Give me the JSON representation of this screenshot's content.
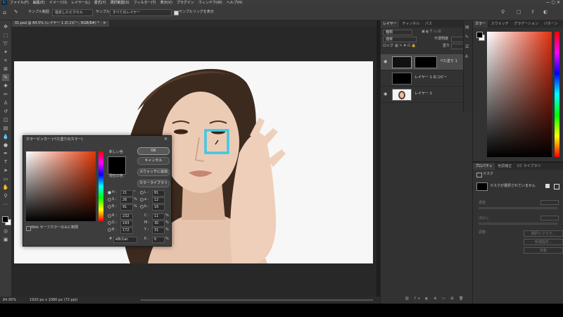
{
  "menu": {
    "logo": "Ps",
    "items": [
      "ファイル(F)",
      "編集(E)",
      "イメージ(I)",
      "レイヤー(L)",
      "書式(Y)",
      "選択範囲(S)",
      "フィルター(T)",
      "表示(V)",
      "プラグイン",
      "ウィンドウ(W)",
      "ヘルプ(H)"
    ]
  },
  "options": {
    "sample_size_label": "サンプル範囲",
    "sample_size_value": "指定したピクセル",
    "sample_label": "サンプル",
    "sample_value": "すべてのレイヤー",
    "show_ring_label": "サンプルリングを表示"
  },
  "document": {
    "tab_title": "01.psd @ 84.5% (レイヤー 1 のコピー, RGB/8#) *",
    "zoom": "84.95%",
    "size_info": "1920 px x 1080 px (72 ppi)"
  },
  "layers_panel": {
    "tabs": [
      "レイヤー",
      "チャンネル",
      "パス"
    ],
    "search_placeholder": "種類",
    "blend_mode": "通常",
    "opacity_label": "不透明度",
    "lock_label": "ロック",
    "fill_label": "塗り",
    "layers": [
      {
        "name": "べた塗り 1",
        "visible": true
      },
      {
        "name": "レイヤー 1 のコピー",
        "visible": false
      },
      {
        "name": "レイヤー 1",
        "visible": true
      }
    ]
  },
  "color_panel": {
    "tabs": [
      "カラー",
      "スウォッチ",
      "グラデーション",
      "パターン"
    ]
  },
  "properties_panel": {
    "tabs": [
      "プロパティ",
      "色調補正",
      "CC ライブラリ"
    ],
    "mask_label": "マスク",
    "mask_status": "マスクが選択されていません",
    "density_label": "濃度",
    "feather_label": "ぼかし",
    "refine_label": "調整:",
    "button1": "選択とマスク...",
    "button2": "色域指定...",
    "button3": "反転"
  },
  "color_picker": {
    "title": "カラーピッカー (べた塗りのカラー)",
    "new_label": "新しい色",
    "current_label": "現在の色",
    "buttons": {
      "ok": "OK",
      "cancel": "キャンセル",
      "add_swatch": "スウォッチに追加",
      "libraries": "カラーライブラリ"
    },
    "fields": {
      "H": {
        "label": "H :",
        "value": "21",
        "unit": "°"
      },
      "S": {
        "label": "S :",
        "value": "26",
        "unit": "%"
      },
      "B": {
        "label": "B :",
        "value": "91",
        "unit": "%"
      },
      "R": {
        "label": "R :",
        "value": "232"
      },
      "G": {
        "label": "G :",
        "value": "193"
      },
      "Bl": {
        "label": "B :",
        "value": "172"
      },
      "L": {
        "label": "L :",
        "value": "81"
      },
      "a": {
        "label": "a :",
        "value": "12"
      },
      "b": {
        "label": "b :",
        "value": "16"
      },
      "C": {
        "label": "C :",
        "value": "11",
        "unit": "%"
      },
      "M": {
        "label": "M :",
        "value": "30",
        "unit": "%"
      },
      "Y": {
        "label": "Y :",
        "value": "31",
        "unit": "%"
      },
      "K": {
        "label": "K :",
        "value": "0",
        "unit": "%"
      }
    },
    "hex_label": "#",
    "hex_value": "e8c1ac",
    "web_safe_label": "Web セーフカラーのみに制限"
  },
  "colors": {
    "accent": "#3ec7e6",
    "picked": "#e8c1ac"
  }
}
